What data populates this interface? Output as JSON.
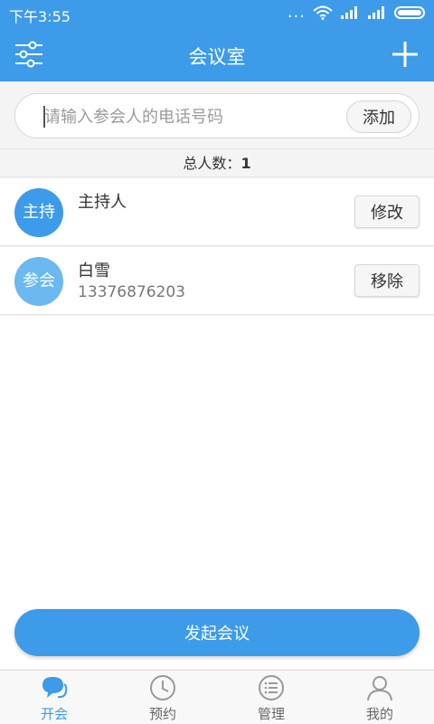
{
  "status_bar": {
    "time": "下午3:55",
    "dots": "...",
    "icons": [
      "wifi-icon",
      "signal-icon",
      "signal-icon",
      "battery-icon"
    ]
  },
  "app_bar": {
    "title": "会议室",
    "left_icon": "settings-sliders-icon",
    "right_icon": "plus-icon"
  },
  "search": {
    "placeholder": "请输入参会人的电话号码",
    "value": "",
    "add_label": "添加"
  },
  "count": {
    "label": "总人数：",
    "value": "1"
  },
  "participants": [
    {
      "avatar_text": "主持",
      "name": "主持人",
      "phone": "",
      "action_label": "修改"
    },
    {
      "avatar_text": "参会",
      "name": "白雪",
      "phone": "13376876203",
      "action_label": "移除"
    }
  ],
  "start_button": {
    "label": "发起会议"
  },
  "bottom_nav": {
    "items": [
      {
        "label": "开会",
        "icon": "chat-bubble-icon",
        "active": true
      },
      {
        "label": "预约",
        "icon": "clock-icon",
        "active": false
      },
      {
        "label": "管理",
        "icon": "list-icon",
        "active": false
      },
      {
        "label": "我的",
        "icon": "user-icon",
        "active": false
      }
    ]
  },
  "colors": {
    "primary": "#3d9be9",
    "guest_avatar": "#6cb8f0"
  }
}
